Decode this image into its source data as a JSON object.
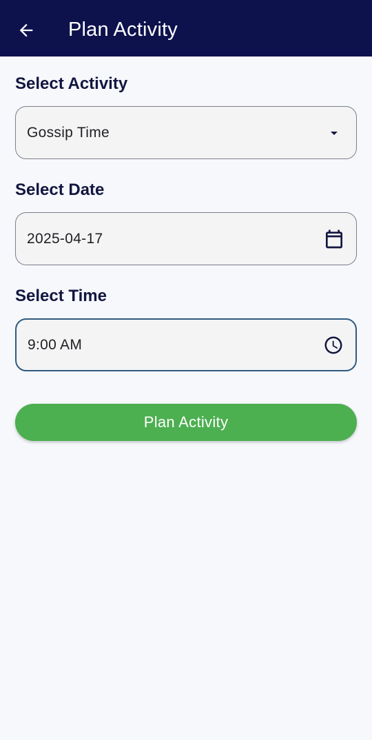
{
  "app_bar": {
    "title": "Plan Activity",
    "back_icon": "arrow-back-icon",
    "background": "#0d124d"
  },
  "form": {
    "activity": {
      "label": "Select Activity",
      "value": "Gossip Time",
      "icon": "dropdown-arrow-icon"
    },
    "date": {
      "label": "Select Date",
      "value": "2025-04-17",
      "icon": "calendar-icon"
    },
    "time": {
      "label": "Select Time",
      "value": "9:00 AM",
      "icon": "clock-icon"
    }
  },
  "submit": {
    "label": "Plan Activity",
    "color": "#4caf50"
  }
}
